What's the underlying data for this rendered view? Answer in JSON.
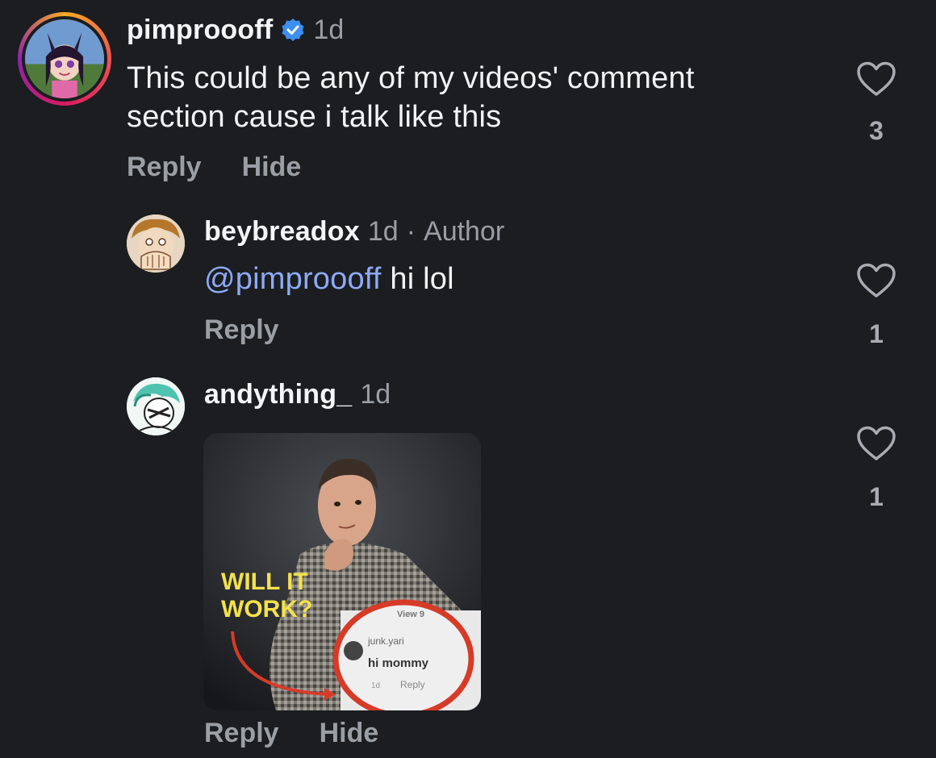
{
  "colors": {
    "background": "#1b1d20",
    "text": "#f2f3f5",
    "muted": "#9a9ea5",
    "mention": "#8eaaf7",
    "verified": "#3d8ef0"
  },
  "comments": [
    {
      "username": "pimproooff",
      "verified": true,
      "time": "1d",
      "text_lines": [
        "This could be any of my videos' comment",
        "section cause i talk like this"
      ],
      "actions": [
        "Reply",
        "Hide"
      ],
      "likes": "3",
      "icon": "heart-outline-icon"
    },
    {
      "username": "beybreadox",
      "time": "1d",
      "separator": "·",
      "role": "Author",
      "mention": "@pimproooff",
      "text": "hi lol",
      "actions": [
        "Reply"
      ],
      "likes": "1",
      "icon": "heart-outline-icon"
    },
    {
      "username": "andything_",
      "time": "1d",
      "gif": {
        "headline_line1": "WILL IT",
        "headline_line2": "WORK?",
        "inset_view": "View 9",
        "inset_user": "junk.yari",
        "inset_text": "hi mommy",
        "inset_time": "1d",
        "inset_reply": "Reply"
      },
      "actions": [
        "Reply",
        "Hide"
      ],
      "likes": "1",
      "icon": "heart-outline-icon"
    }
  ]
}
